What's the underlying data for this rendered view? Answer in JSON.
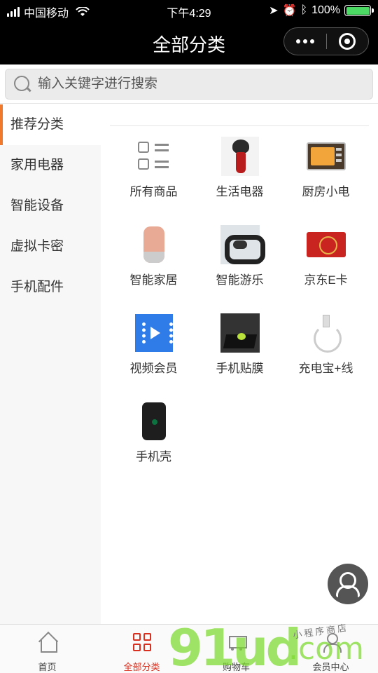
{
  "status_bar": {
    "carrier": "中国移动",
    "time": "下午4:29",
    "battery": "100%",
    "battery_level": 1.0
  },
  "nav": {
    "title": "全部分类"
  },
  "search": {
    "placeholder": "输入关键字进行搜索"
  },
  "sidebar": {
    "items": [
      {
        "label": "推荐分类",
        "active": true
      },
      {
        "label": "家用电器"
      },
      {
        "label": "智能设备"
      },
      {
        "label": "虚拟卡密"
      },
      {
        "label": "手机配件"
      }
    ]
  },
  "grid": {
    "items": [
      {
        "label": "所有商品",
        "icon": "all-products-icon"
      },
      {
        "label": "生活电器",
        "icon": "shaver-image"
      },
      {
        "label": "厨房小电",
        "icon": "oven-image"
      },
      {
        "label": "智能家居",
        "icon": "smart-home-image"
      },
      {
        "label": "智能游乐",
        "icon": "smart-band-image"
      },
      {
        "label": "京东E卡",
        "icon": "gift-card-image"
      },
      {
        "label": "视频会员",
        "icon": "video-icon"
      },
      {
        "label": "手机贴膜",
        "icon": "screen-film-image"
      },
      {
        "label": "充电宝+线",
        "icon": "cable-image"
      },
      {
        "label": "手机壳",
        "icon": "phone-case-image"
      }
    ]
  },
  "tabbar": {
    "items": [
      {
        "label": "首页",
        "icon": "home-icon"
      },
      {
        "label": "全部分类",
        "icon": "category-icon",
        "active": true
      },
      {
        "label": "购物车",
        "icon": "cart-icon"
      },
      {
        "label": "会员中心",
        "icon": "user-icon"
      }
    ]
  },
  "watermark": {
    "text_big": "91ud",
    "text_com": ".com",
    "text_small": "小程序商店"
  },
  "colors": {
    "accent": "#d92f1e",
    "sidebar_active": "#f0792b",
    "nav_bg": "#000000"
  }
}
